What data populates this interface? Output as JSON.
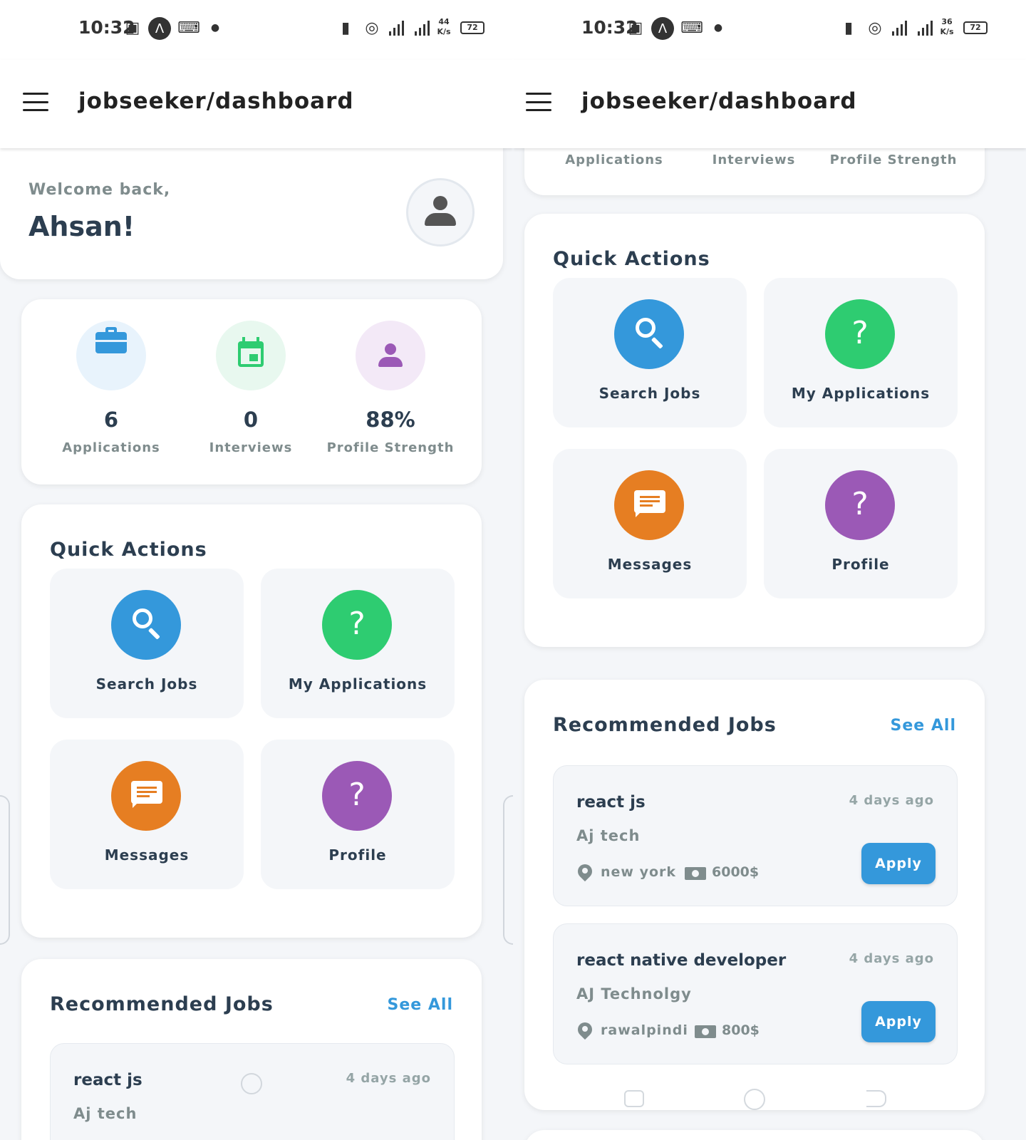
{
  "status_bar": {
    "left": {
      "time": "10:32",
      "net_top": "44",
      "net_bottom": "K/s",
      "battery": "72"
    },
    "right": {
      "time": "10:32",
      "net_top": "36",
      "net_bottom": "K/s",
      "battery": "72"
    },
    "signal_label": "4G"
  },
  "appbar": {
    "title": "jobseeker/dashboard"
  },
  "welcome": {
    "greeting": "Welcome back,",
    "name": "Ahsan!"
  },
  "stats": [
    {
      "value": "6",
      "label": "Applications",
      "icon": "briefcase-icon",
      "color": "#3498db",
      "bg": "#e8f3fc"
    },
    {
      "value": "0",
      "label": "Interviews",
      "icon": "calendar-icon",
      "color": "#2ecc71",
      "bg": "#e8f8ef"
    },
    {
      "value": "88%",
      "label": "Profile Strength",
      "icon": "person-icon",
      "color": "#9b59b6",
      "bg": "#f3e9f7"
    }
  ],
  "quick_actions": {
    "title": "Quick Actions",
    "items": [
      {
        "label": "Search Jobs",
        "icon": "search-icon",
        "color": "#3498db"
      },
      {
        "label": "My Applications",
        "icon": "question-icon",
        "glyph": "?",
        "color": "#2ecc71"
      },
      {
        "label": "Messages",
        "icon": "message-icon",
        "color": "#e67e22"
      },
      {
        "label": "Profile",
        "icon": "question-icon",
        "glyph": "?",
        "color": "#9b59b6"
      }
    ]
  },
  "recommended": {
    "title": "Recommended Jobs",
    "see_all": "See All",
    "jobs": [
      {
        "title": "react js",
        "company": "Aj tech",
        "posted": "4 days ago",
        "location": "new york",
        "salary": "6000$",
        "apply": "Apply"
      },
      {
        "title": "react native developer",
        "company": "AJ Technolgy",
        "posted": "4 days ago",
        "location": "rawalpindi",
        "salary": "800$",
        "apply": "Apply"
      }
    ]
  },
  "colors": {
    "accent": "#3498db",
    "text_dark": "#2c3e50",
    "text_muted": "#7f8c8d",
    "background": "#f4f6f9"
  }
}
